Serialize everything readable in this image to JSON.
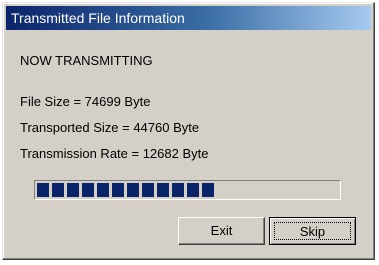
{
  "window": {
    "title": "Transmitted File Information"
  },
  "status": {
    "text": "NOW TRANSMITTING"
  },
  "info": {
    "file_size": "File Size = 74699 Byte",
    "transported_size": "Transported Size = 44760 Byte",
    "transmission_rate": "Transmission Rate = 12682 Byte"
  },
  "progress": {
    "fraction": 0.6,
    "color": "#0a246a"
  },
  "buttons": {
    "exit_label": "Exit",
    "skip_label": "Skip"
  }
}
